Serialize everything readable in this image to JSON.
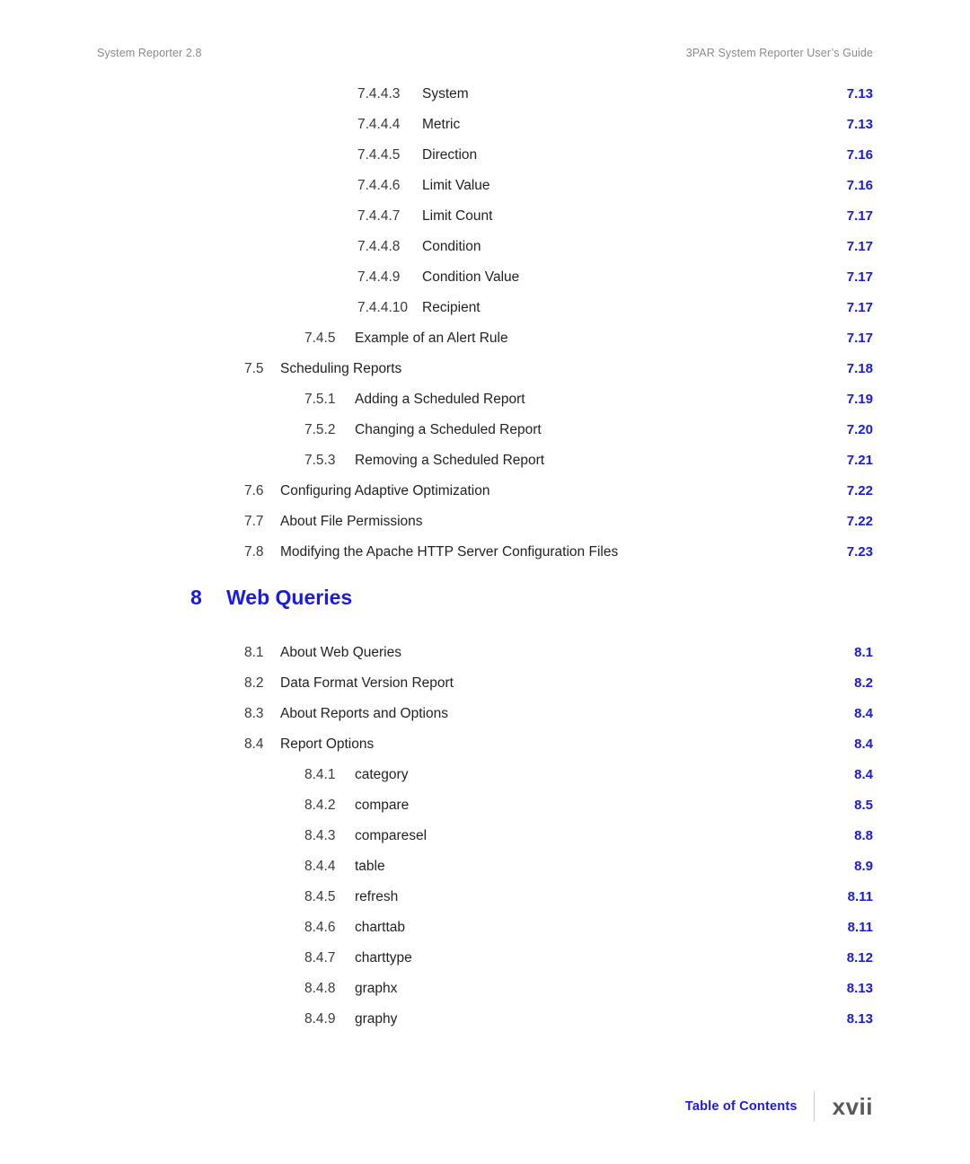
{
  "header": {
    "left": "System Reporter 2.8",
    "right": "3PAR System Reporter User’s Guide"
  },
  "toc": {
    "entries": [
      {
        "level": 3,
        "number": "7.4.4.3",
        "label": "System",
        "page": "7.13"
      },
      {
        "level": 3,
        "number": "7.4.4.4",
        "label": "Metric",
        "page": "7.13"
      },
      {
        "level": 3,
        "number": "7.4.4.5",
        "label": "Direction",
        "page": "7.16"
      },
      {
        "level": 3,
        "number": "7.4.4.6",
        "label": "Limit Value",
        "page": "7.16"
      },
      {
        "level": 3,
        "number": "7.4.4.7",
        "label": "Limit Count",
        "page": "7.17"
      },
      {
        "level": 3,
        "number": "7.4.4.8",
        "label": "Condition",
        "page": "7.17"
      },
      {
        "level": 3,
        "number": "7.4.4.9",
        "label": "Condition Value",
        "page": "7.17"
      },
      {
        "level": 3,
        "number": "7.4.4.10",
        "label": "Recipient",
        "page": "7.17"
      },
      {
        "level": 2,
        "number": "7.4.5",
        "label": "Example of an Alert Rule",
        "page": "7.17"
      },
      {
        "level": 1,
        "number": "7.5",
        "label": "Scheduling Reports",
        "page": "7.18"
      },
      {
        "level": 2,
        "number": "7.5.1",
        "label": "Adding a Scheduled Report",
        "page": "7.19"
      },
      {
        "level": 2,
        "number": "7.5.2",
        "label": "Changing a Scheduled Report",
        "page": "7.20"
      },
      {
        "level": 2,
        "number": "7.5.3",
        "label": "Removing a Scheduled Report",
        "page": "7.21"
      },
      {
        "level": 1,
        "number": "7.6",
        "label": "Configuring Adaptive Optimization",
        "page": "7.22"
      },
      {
        "level": 1,
        "number": "7.7",
        "label": "About File Permissions",
        "page": "7.22"
      },
      {
        "level": 1,
        "number": "7.8",
        "label": "Modifying the Apache HTTP Server Configuration Files",
        "page": "7.23"
      }
    ]
  },
  "chapter": {
    "number": "8",
    "title": "Web Queries",
    "entries": [
      {
        "level": 1,
        "number": "8.1",
        "label": "About Web Queries",
        "page": "8.1"
      },
      {
        "level": 1,
        "number": "8.2",
        "label": "Data Format Version Report",
        "page": "8.2"
      },
      {
        "level": 1,
        "number": "8.3",
        "label": "About Reports and Options",
        "page": "8.4"
      },
      {
        "level": 1,
        "number": "8.4",
        "label": "Report Options",
        "page": "8.4"
      },
      {
        "level": 2,
        "number": "8.4.1",
        "label": "category",
        "page": "8.4"
      },
      {
        "level": 2,
        "number": "8.4.2",
        "label": "compare",
        "page": "8.5"
      },
      {
        "level": 2,
        "number": "8.4.3",
        "label": "comparesel",
        "page": "8.8"
      },
      {
        "level": 2,
        "number": "8.4.4",
        "label": "table",
        "page": "8.9"
      },
      {
        "level": 2,
        "number": "8.4.5",
        "label": "refresh",
        "page": "8.11"
      },
      {
        "level": 2,
        "number": "8.4.6",
        "label": "charttab",
        "page": "8.11"
      },
      {
        "level": 2,
        "number": "8.4.7",
        "label": "charttype",
        "page": "8.12"
      },
      {
        "level": 2,
        "number": "8.4.8",
        "label": "graphx",
        "page": "8.13"
      },
      {
        "level": 2,
        "number": "8.4.9",
        "label": "graphy",
        "page": "8.13"
      }
    ]
  },
  "footer": {
    "label": "Table of Contents",
    "folio": "xvii"
  },
  "colors": {
    "link_blue": "#1a1ae0",
    "body_text": "#231f20",
    "header_gray": "#8a8a8a",
    "folio_gray": "#58595b",
    "divider_gray": "#c9c9c9"
  }
}
